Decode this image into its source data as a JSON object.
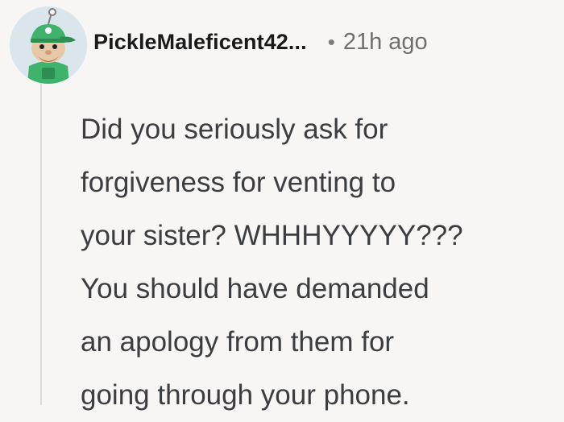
{
  "comment": {
    "avatar_icon": "snoo-avatar-icon",
    "username": "PickleMaleficent42...",
    "separator": "•",
    "timestamp": "21h ago",
    "body_lines": [
      "Did you seriously ask for",
      "forgiveness for venting to",
      "your sister? WHHHYYYYY???",
      "You should have demanded",
      "an apology from them for",
      "going through your phone."
    ]
  },
  "colors": {
    "background": "#f7f6f5",
    "username": "#1a1a1b",
    "body_text": "#3b3d40",
    "meta_text": "#6f6f6f",
    "avatar_accent": "#3fb36b",
    "thread_line": "#dcdcdc"
  }
}
